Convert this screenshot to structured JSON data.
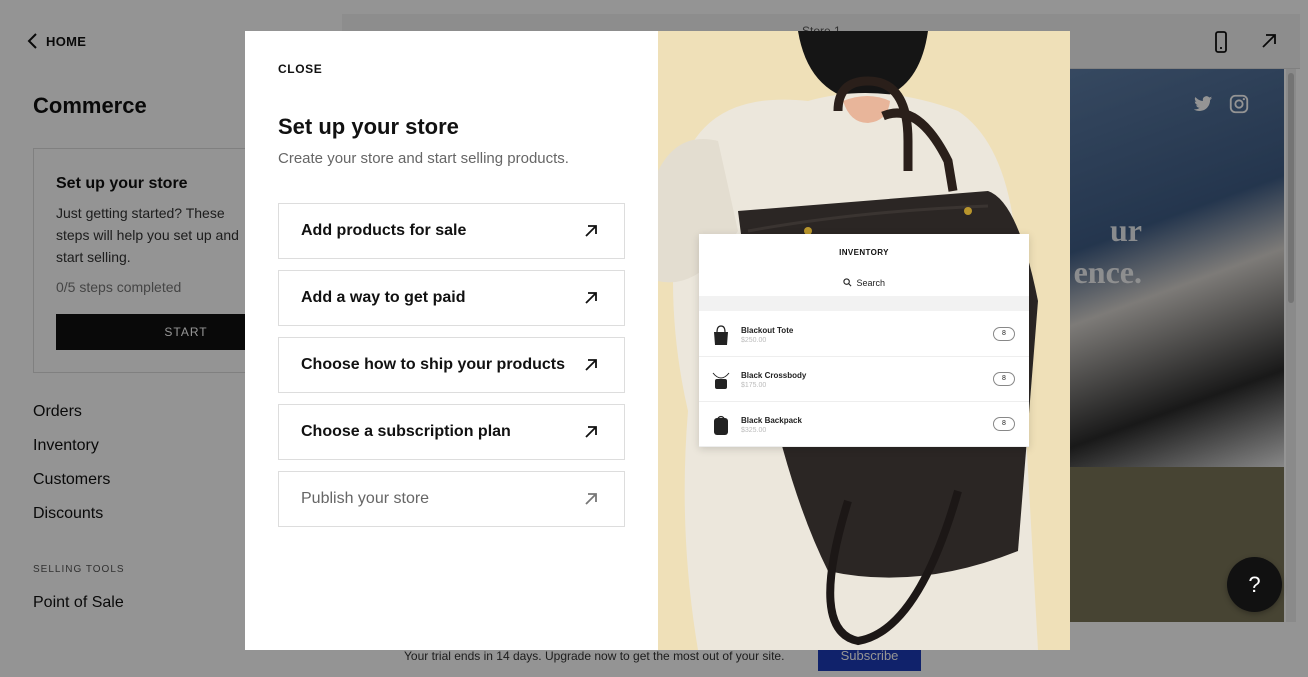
{
  "sidebar": {
    "home_label": "HOME",
    "title": "Commerce",
    "setup_card": {
      "title": "Set up your store",
      "description": "Just getting started? These steps will help you set up and start selling.",
      "steps_completed": "0/5 steps completed",
      "start_label": "START"
    },
    "nav_items": [
      {
        "label": "Orders"
      },
      {
        "label": "Inventory"
      },
      {
        "label": "Customers"
      },
      {
        "label": "Discounts"
      }
    ],
    "selling_tools_label": "SELLING TOOLS",
    "point_of_sale_label": "Point of Sale"
  },
  "preview": {
    "site_name": "Store 1",
    "hero_text_line1": "ur",
    "hero_text_line2": "ence."
  },
  "trial": {
    "text": "Your trial ends in 14 days. Upgrade now to get the most out of your site.",
    "subscribe_label": "Subscribe"
  },
  "help_label": "?",
  "modal": {
    "close_label": "CLOSE",
    "title": "Set up your store",
    "subtitle": "Create your store and start selling products.",
    "steps": [
      {
        "label": "Add products for sale",
        "muted": false
      },
      {
        "label": "Add a way to get paid",
        "muted": false
      },
      {
        "label": "Choose how to ship your products",
        "muted": false
      },
      {
        "label": "Choose a subscription plan",
        "muted": false
      },
      {
        "label": "Publish your store",
        "muted": true
      }
    ]
  },
  "inventory": {
    "title": "INVENTORY",
    "search_label": "Search",
    "items": [
      {
        "name": "Blackout Tote",
        "price": "$250.00",
        "qty": "8"
      },
      {
        "name": "Black Crossbody",
        "price": "$175.00",
        "qty": "8"
      },
      {
        "name": "Black Backpack",
        "price": "$325.00",
        "qty": "8"
      }
    ]
  },
  "colors": {
    "subscribe_blue": "#1d3bb8",
    "start_black": "#111111",
    "modal_image_bg": "#efe0b8"
  }
}
